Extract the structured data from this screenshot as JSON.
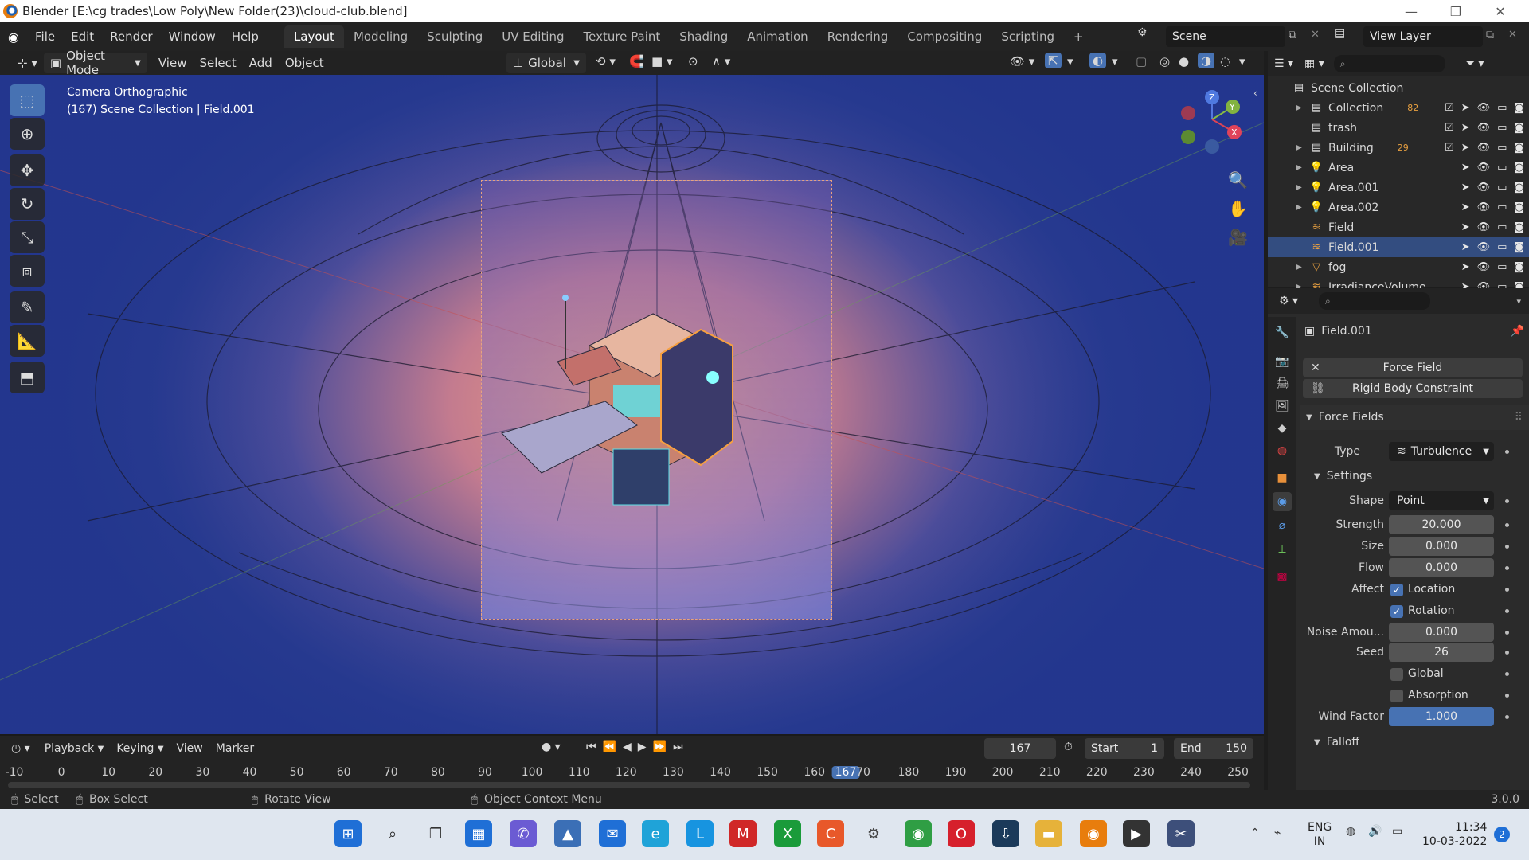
{
  "window": {
    "title": "Blender [E:\\cg trades\\Low Poly\\New Folder(23)\\cloud-club.blend]"
  },
  "menu": {
    "items": [
      "File",
      "Edit",
      "Render",
      "Window",
      "Help"
    ],
    "workspaces": [
      "Layout",
      "Modeling",
      "Sculpting",
      "UV Editing",
      "Texture Paint",
      "Shading",
      "Animation",
      "Rendering",
      "Compositing",
      "Scripting"
    ],
    "scene": "Scene",
    "view_layer": "View Layer"
  },
  "viewport_header": {
    "mode": "Object Mode",
    "menus": [
      "View",
      "Select",
      "Add",
      "Object"
    ],
    "orientation": "Global"
  },
  "viewport": {
    "camera_label": "Camera Orthographic",
    "collection_label": "(167) Scene Collection | Field.001",
    "gizmo_axes": [
      "Z",
      "Y",
      "X"
    ]
  },
  "outliner": {
    "root": "Scene Collection",
    "rows": [
      {
        "name": "Collection",
        "badge": "82",
        "type": "collection"
      },
      {
        "name": "trash",
        "type": "collection"
      },
      {
        "name": "Building",
        "badge": "29",
        "type": "collection"
      },
      {
        "name": "Area",
        "type": "light"
      },
      {
        "name": "Area.001",
        "type": "light"
      },
      {
        "name": "Area.002",
        "type": "light"
      },
      {
        "name": "Field",
        "type": "field"
      },
      {
        "name": "Field.001",
        "type": "field",
        "selected": true
      },
      {
        "name": "fog",
        "type": "mesh"
      },
      {
        "name": "IrradianceVolume",
        "type": "probe"
      }
    ]
  },
  "properties": {
    "object_name": "Field.001",
    "buttons": [
      "Force Field",
      "Rigid Body Constraint"
    ],
    "panel_title": "Force Fields",
    "type_label": "Type",
    "type_value": "Turbulence",
    "settings_title": "Settings",
    "shape_label": "Shape",
    "shape_value": "Point",
    "strength_label": "Strength",
    "strength_value": "20.000",
    "size_label": "Size",
    "size_value": "0.000",
    "flow_label": "Flow",
    "flow_value": "0.000",
    "affect_label": "Affect",
    "affect_location": "Location",
    "affect_rotation": "Rotation",
    "noise_label": "Noise Amou...",
    "noise_value": "0.000",
    "seed_label": "Seed",
    "seed_value": "26",
    "global_label": "Global",
    "absorption_label": "Absorption",
    "wind_label": "Wind Factor",
    "wind_value": "1.000",
    "falloff_title": "Falloff"
  },
  "timeline": {
    "menus": [
      "Playback",
      "Keying",
      "View",
      "Marker"
    ],
    "current_frame": "167",
    "start_label": "Start",
    "start_value": "1",
    "end_label": "End",
    "end_value": "150",
    "ticks": [
      "-10",
      "0",
      "10",
      "20",
      "30",
      "40",
      "50",
      "60",
      "70",
      "80",
      "90",
      "100",
      "110",
      "120",
      "130",
      "140",
      "150",
      "160",
      "167",
      "70",
      "180",
      "190",
      "200",
      "210",
      "220",
      "230",
      "240",
      "250"
    ]
  },
  "statusbar": {
    "select": "Select",
    "box_select": "Box Select",
    "rotate_view": "Rotate View",
    "context_menu": "Object Context Menu",
    "version": "3.0.0"
  },
  "taskbar": {
    "lang_top": "ENG",
    "lang_bottom": "IN",
    "time": "11:34",
    "date": "10-03-2022",
    "notif_count": "2"
  }
}
